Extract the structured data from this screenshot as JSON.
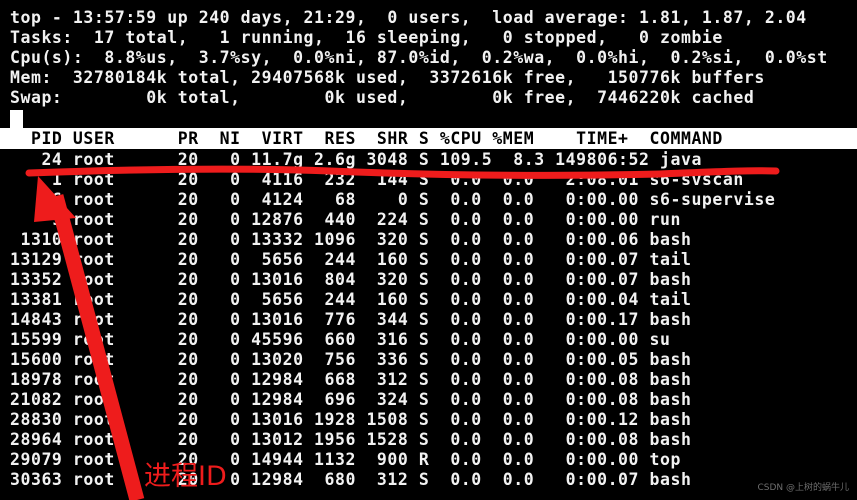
{
  "terminal": {
    "summary_lines": [
      "top - 13:57:59 up 240 days, 21:29,  0 users,  load average: 1.81, 1.87, 2.04",
      "Tasks:  17 total,   1 running,  16 sleeping,   0 stopped,   0 zombie",
      "Cpu(s):  8.8%us,  3.7%sy,  0.0%ni, 87.0%id,  0.2%wa,  0.0%hi,  0.2%si,  0.0%st",
      "Mem:  32780184k total, 29407568k used,  3372616k free,   150776k buffers",
      "Swap:        0k total,        0k used,        0k free,  7446220k cached"
    ],
    "uptime": {
      "time": "13:57:59",
      "up": "240 days, 21:29",
      "users": "0",
      "load_average": [
        "1.81",
        "1.87",
        "2.04"
      ]
    },
    "tasks": {
      "total": "17",
      "running": "1",
      "sleeping": "16",
      "stopped": "0",
      "zombie": "0"
    },
    "cpu": {
      "us": "8.8",
      "sy": "3.7",
      "ni": "0.0",
      "id": "87.0",
      "wa": "0.2",
      "hi": "0.0",
      "si": "0.2",
      "st": "0.0"
    },
    "mem": {
      "total": "32780184k",
      "used": "29407568k",
      "free": "3372616k",
      "buffers": "150776k"
    },
    "swap": {
      "total": "0k",
      "used": "0k",
      "free": "0k",
      "cached": "7446220k"
    },
    "header_line": "  PID USER      PR  NI  VIRT  RES  SHR S %CPU %MEM    TIME+  COMMAND",
    "columns": [
      "PID",
      "USER",
      "PR",
      "NI",
      "VIRT",
      "RES",
      "SHR",
      "S",
      "%CPU",
      "%MEM",
      "TIME+",
      "COMMAND"
    ],
    "rows": [
      "   24 root      20   0 11.7g 2.6g 3048 S 109.5  8.3 149806:52 java",
      "    1 root      20   0  4116  232  144 S  0.0  0.0   2:08.01 s6-svscan",
      "    6 root      20   0  4124   68    0 S  0.0  0.0   0:00.00 s6-supervise",
      "    9 root      20   0 12876  440  224 S  0.0  0.0   0:00.00 run",
      " 1310 root      20   0 13332 1096  320 S  0.0  0.0   0:00.06 bash",
      "13129 root      20   0  5656  244  160 S  0.0  0.0   0:00.07 tail",
      "13352 root      20   0 13016  804  320 S  0.0  0.0   0:00.07 bash",
      "13381 root      20   0  5656  244  160 S  0.0  0.0   0:00.04 tail",
      "14843 root      20   0 13016  776  344 S  0.0  0.0   0:00.17 bash",
      "15599 root      20   0 45596  660  316 S  0.0  0.0   0:00.00 su",
      "15600 root      20   0 13020  756  336 S  0.0  0.0   0:00.05 bash",
      "18978 root      20   0 12984  668  312 S  0.0  0.0   0:00.08 bash",
      "21082 root      20   0 12984  696  324 S  0.0  0.0   0:00.08 bash",
      "28830 root      20   0 13016 1928 1508 S  0.0  0.0   0:00.12 bash",
      "28964 root      20   0 13012 1956 1528 S  0.0  0.0   0:00.08 bash",
      "29079 root      20   0 14944 1132  900 R  0.0  0.0   0:00.00 top",
      "30363 root      20   0 12984  680  312 S  0.0  0.0   0:00.07 bash"
    ],
    "processes": [
      {
        "pid": "24",
        "user": "root",
        "pr": "20",
        "ni": "0",
        "virt": "11.7g",
        "res": "2.6g",
        "shr": "3048",
        "s": "S",
        "cpu": "109.5",
        "mem": "8.3",
        "time": "149806:52",
        "command": "java"
      },
      {
        "pid": "1",
        "user": "root",
        "pr": "20",
        "ni": "0",
        "virt": "4116",
        "res": "232",
        "shr": "144",
        "s": "S",
        "cpu": "0.0",
        "mem": "0.0",
        "time": "2:08.01",
        "command": "s6-svscan"
      },
      {
        "pid": "6",
        "user": "root",
        "pr": "20",
        "ni": "0",
        "virt": "4124",
        "res": "68",
        "shr": "0",
        "s": "S",
        "cpu": "0.0",
        "mem": "0.0",
        "time": "0:00.00",
        "command": "s6-supervise"
      },
      {
        "pid": "9",
        "user": "root",
        "pr": "20",
        "ni": "0",
        "virt": "12876",
        "res": "440",
        "shr": "224",
        "s": "S",
        "cpu": "0.0",
        "mem": "0.0",
        "time": "0:00.00",
        "command": "run"
      },
      {
        "pid": "1310",
        "user": "root",
        "pr": "20",
        "ni": "0",
        "virt": "13332",
        "res": "1096",
        "shr": "320",
        "s": "S",
        "cpu": "0.0",
        "mem": "0.0",
        "time": "0:00.06",
        "command": "bash"
      },
      {
        "pid": "13129",
        "user": "root",
        "pr": "20",
        "ni": "0",
        "virt": "5656",
        "res": "244",
        "shr": "160",
        "s": "S",
        "cpu": "0.0",
        "mem": "0.0",
        "time": "0:00.07",
        "command": "tail"
      },
      {
        "pid": "13352",
        "user": "root",
        "pr": "20",
        "ni": "0",
        "virt": "13016",
        "res": "804",
        "shr": "320",
        "s": "S",
        "cpu": "0.0",
        "mem": "0.0",
        "time": "0:00.07",
        "command": "bash"
      },
      {
        "pid": "13381",
        "user": "root",
        "pr": "20",
        "ni": "0",
        "virt": "5656",
        "res": "244",
        "shr": "160",
        "s": "S",
        "cpu": "0.0",
        "mem": "0.0",
        "time": "0:00.04",
        "command": "tail"
      },
      {
        "pid": "14843",
        "user": "root",
        "pr": "20",
        "ni": "0",
        "virt": "13016",
        "res": "776",
        "shr": "344",
        "s": "S",
        "cpu": "0.0",
        "mem": "0.0",
        "time": "0:00.17",
        "command": "bash"
      },
      {
        "pid": "15599",
        "user": "root",
        "pr": "20",
        "ni": "0",
        "virt": "45596",
        "res": "660",
        "shr": "316",
        "s": "S",
        "cpu": "0.0",
        "mem": "0.0",
        "time": "0:00.00",
        "command": "su"
      },
      {
        "pid": "15600",
        "user": "root",
        "pr": "20",
        "ni": "0",
        "virt": "13020",
        "res": "756",
        "shr": "336",
        "s": "S",
        "cpu": "0.0",
        "mem": "0.0",
        "time": "0:00.05",
        "command": "bash"
      },
      {
        "pid": "18978",
        "user": "root",
        "pr": "20",
        "ni": "0",
        "virt": "12984",
        "res": "668",
        "shr": "312",
        "s": "S",
        "cpu": "0.0",
        "mem": "0.0",
        "time": "0:00.08",
        "command": "bash"
      },
      {
        "pid": "21082",
        "user": "root",
        "pr": "20",
        "ni": "0",
        "virt": "12984",
        "res": "696",
        "shr": "324",
        "s": "S",
        "cpu": "0.0",
        "mem": "0.0",
        "time": "0:00.08",
        "command": "bash"
      },
      {
        "pid": "28830",
        "user": "root",
        "pr": "20",
        "ni": "0",
        "virt": "13016",
        "res": "1928",
        "shr": "1508",
        "s": "S",
        "cpu": "0.0",
        "mem": "0.0",
        "time": "0:00.12",
        "command": "bash"
      },
      {
        "pid": "28964",
        "user": "root",
        "pr": "20",
        "ni": "0",
        "virt": "13012",
        "res": "1956",
        "shr": "1528",
        "s": "S",
        "cpu": "0.0",
        "mem": "0.0",
        "time": "0:00.08",
        "command": "bash"
      },
      {
        "pid": "29079",
        "user": "root",
        "pr": "20",
        "ni": "0",
        "virt": "14944",
        "res": "1132",
        "shr": "900",
        "s": "R",
        "cpu": "0.0",
        "mem": "0.0",
        "time": "0:00.00",
        "command": "top"
      },
      {
        "pid": "30363",
        "user": "root",
        "pr": "20",
        "ni": "0",
        "virt": "12984",
        "res": "680",
        "shr": "312",
        "s": "S",
        "cpu": "0.0",
        "mem": "0.0",
        "time": "0:00.07",
        "command": "bash"
      }
    ]
  },
  "annotations": {
    "label": "进程ID",
    "color": "#ee1c1c",
    "watermark": "CSDN @上树的蜗牛儿"
  },
  "colors": {
    "background": "#000000",
    "foreground": "#f2f2f2",
    "header_bg": "#ffffff",
    "header_fg": "#000000",
    "annotation": "#ee1c1c"
  }
}
